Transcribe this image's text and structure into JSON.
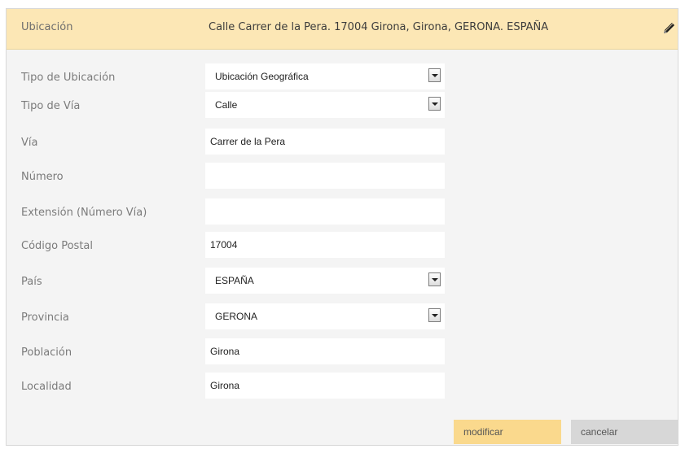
{
  "header": {
    "label": "Ubicación",
    "value": "Calle Carrer de la Pera. 17004 Girona, Girona, GERONA. ESPAÑA",
    "edit_icon": "pencil-icon"
  },
  "form": {
    "tipo_ubicacion": {
      "label": "Tipo de Ubicación",
      "value": "Ubicación Geográfica"
    },
    "tipo_via": {
      "label": "Tipo de Vía",
      "value": "Calle"
    },
    "via": {
      "label": "Vía",
      "value": "Carrer de la Pera"
    },
    "numero": {
      "label": "Número",
      "value": ""
    },
    "extension": {
      "label": "Extensión (Número Vía)",
      "value": ""
    },
    "codigo_postal": {
      "label": "Código Postal",
      "value": "17004"
    },
    "pais": {
      "label": "País",
      "value": "ESPAÑA"
    },
    "provincia": {
      "label": "Provincia",
      "value": "GERONA"
    },
    "poblacion": {
      "label": "Población",
      "value": "Girona"
    },
    "localidad": {
      "label": "Localidad",
      "value": "Girona"
    }
  },
  "actions": {
    "modify_label": "modificar",
    "cancel_label": "cancelar"
  },
  "colors": {
    "header_bg": "#fce7b5",
    "modify_bg": "#fad98d",
    "cancel_bg": "#d7d7d7",
    "panel_bg": "#f4f4f4"
  }
}
